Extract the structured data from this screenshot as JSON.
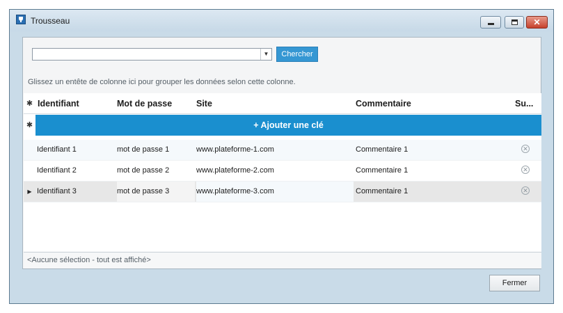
{
  "window": {
    "title": "Trousseau",
    "controls": {
      "minimize_icon": "minimize-icon",
      "maximize_icon": "maximize-icon",
      "close_icon": "close-icon",
      "close_glyph": "✕"
    }
  },
  "search": {
    "value": "",
    "button_label": "Chercher"
  },
  "grid": {
    "group_hint": "Glissez un entête de colonne ici pour grouper les données selon cette colonne.",
    "header_indicator": "✱",
    "columns": [
      "Identifiant",
      "Mot de passe",
      "Site",
      "Commentaire",
      "Su..."
    ],
    "add_row": {
      "indicator": "✱",
      "label": "+ Ajouter une clé"
    },
    "rows": [
      {
        "identifiant": "Identifiant 1",
        "mot_de_passe": "mot de passe 1",
        "site": "www.plateforme-1.com",
        "commentaire": "Commentaire 1",
        "indicator": ""
      },
      {
        "identifiant": "Identifiant 2",
        "mot_de_passe": "mot de passe 2",
        "site": "www.plateforme-2.com",
        "commentaire": "Commentaire 1",
        "indicator": ""
      },
      {
        "identifiant": "Identifiant 3",
        "mot_de_passe": "mot de passe 3",
        "site": "www.plateforme-3.com",
        "commentaire": "Commentaire 1",
        "indicator": "▶"
      }
    ],
    "delete_glyph": "✕",
    "status": "<Aucune sélection - tout est affiché>"
  },
  "footer": {
    "close_label": "Fermer"
  },
  "colors": {
    "accent": "#1a8fcf",
    "search_button": "#3597d3",
    "selected_row": "#e7e7e7"
  }
}
